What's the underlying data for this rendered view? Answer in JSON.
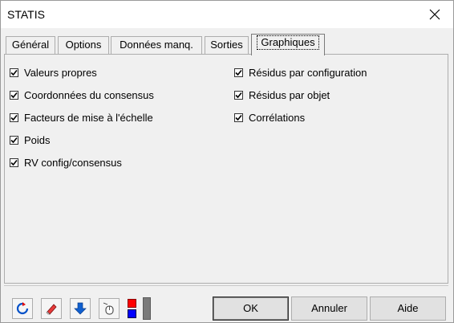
{
  "window": {
    "title": "STATIS"
  },
  "tabs": [
    {
      "label": "Général"
    },
    {
      "label": "Options"
    },
    {
      "label": "Données manq."
    },
    {
      "label": "Sorties"
    },
    {
      "label": "Graphiques",
      "active": true
    }
  ],
  "options": {
    "left": [
      {
        "label": "Valeurs propres",
        "checked": true
      },
      {
        "label": "Coordonnées du consensus",
        "checked": true
      },
      {
        "label": "Facteurs de mise à l'échelle",
        "checked": true
      },
      {
        "label": "Poids",
        "checked": true
      },
      {
        "label": "RV config/consensus",
        "checked": true
      }
    ],
    "right": [
      {
        "label": "Résidus par configuration",
        "checked": true
      },
      {
        "label": "Résidus par objet",
        "checked": true
      },
      {
        "label": "Corrélations",
        "checked": true
      }
    ]
  },
  "toolbar": {
    "icons": [
      "reset-icon",
      "eraser-icon",
      "arrow-down-icon",
      "mouse-select-icon"
    ],
    "colors": {
      "top": "#ff0000",
      "bottom": "#0000ff"
    }
  },
  "buttons": {
    "ok": "OK",
    "cancel": "Annuler",
    "help": "Aide"
  }
}
